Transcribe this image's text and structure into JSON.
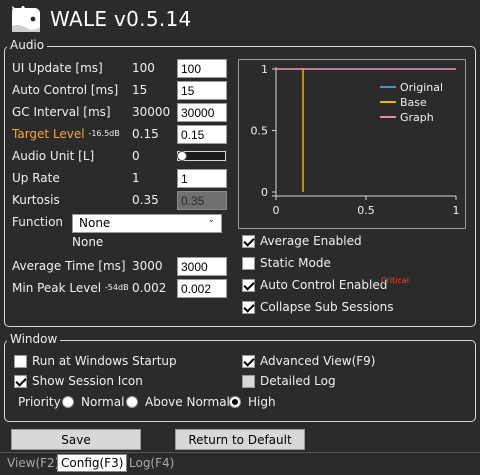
{
  "app": {
    "title": "WALE v0.5.14"
  },
  "audio": {
    "group_label": "Audio",
    "ui_update": {
      "label": "UI Update [ms]",
      "current": "100",
      "input": "100"
    },
    "auto_control": {
      "label": "Auto Control [ms]",
      "current": "15",
      "input": "15"
    },
    "gc_interval": {
      "label": "GC Interval [ms]",
      "current": "30000",
      "input": "30000"
    },
    "target_level": {
      "label": "Target Level",
      "db": "-16.5dB",
      "current": "0.15",
      "input": "0.15"
    },
    "audio_unit": {
      "label": "Audio Unit [L]",
      "current": "0",
      "slider_level": 0
    },
    "up_rate": {
      "label": "Up Rate",
      "current": "1",
      "input": "1"
    },
    "kurtosis": {
      "label": "Kurtosis",
      "current": "0.35",
      "input": "0.35"
    },
    "function": {
      "label": "Function",
      "selected": "None",
      "current": "None"
    },
    "average_time": {
      "label": "Average Time [ms]",
      "current": "3000",
      "input": "3000"
    },
    "min_peak_level": {
      "label": "Min Peak Level",
      "db": "-54dB",
      "current": "0.002",
      "input": "0.002"
    },
    "checks": {
      "average_enabled": {
        "label": "Average Enabled",
        "checked": true
      },
      "static_mode": {
        "label": "Static Mode",
        "checked": false
      },
      "auto_control_enabled": {
        "label": "Auto Control Enabled",
        "badge": "Critical",
        "checked": true
      },
      "collapse_sub_sessions": {
        "label": "Collapse Sub Sessions",
        "checked": true
      }
    }
  },
  "chart_data": {
    "type": "line",
    "xlim": [
      0,
      1
    ],
    "ylim": [
      0,
      1
    ],
    "xticks": [
      "0",
      "0.5",
      "1"
    ],
    "yticks": [
      "0",
      "0.5",
      "1"
    ],
    "legend_position": "top-right",
    "series": [
      {
        "name": "Original",
        "color": "#4a90d9",
        "x": [
          0,
          1
        ],
        "y": [
          1,
          1
        ]
      },
      {
        "name": "Base",
        "color": "#e8b400",
        "x": [
          0.15,
          0.15
        ],
        "y": [
          0,
          1
        ]
      },
      {
        "name": "Graph",
        "color": "#e88aa8",
        "x": [
          0,
          1
        ],
        "y": [
          1,
          1
        ]
      }
    ]
  },
  "window": {
    "group_label": "Window",
    "run_at_startup": {
      "label": "Run at Windows Startup",
      "checked": false
    },
    "show_session_icon": {
      "label": "Show Session Icon",
      "checked": true
    },
    "advanced_view": {
      "label": "Advanced View(F9)",
      "checked": true
    },
    "detailed_log": {
      "label": "Detailed Log",
      "checked": false
    },
    "priority": {
      "label": "Priority",
      "options": [
        "Normal",
        "Above Normal",
        "High"
      ],
      "selected": "High"
    }
  },
  "buttons": {
    "save": "Save",
    "return_default": "Return to Default"
  },
  "tabs": [
    "View(F2)",
    "Config(F3)",
    "Log(F4)"
  ]
}
